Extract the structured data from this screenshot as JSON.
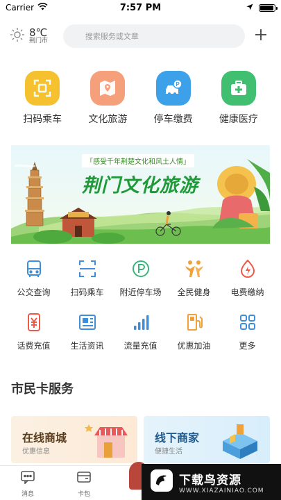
{
  "status_bar": {
    "carrier": "Carrier",
    "time": "7:57 PM",
    "battery_level": 0.95
  },
  "header": {
    "temperature": "8℃",
    "city": "荆门市",
    "search_placeholder": "搜索服务或文章"
  },
  "top_services": [
    {
      "label": "扫码乘车",
      "icon": "scan-icon",
      "color": "#f5c12e"
    },
    {
      "label": "文化旅游",
      "icon": "map-icon",
      "color": "#f5a07a"
    },
    {
      "label": "停车缴费",
      "icon": "car-parking-icon",
      "color": "#3da1ea"
    },
    {
      "label": "健康医疗",
      "icon": "medical-kit-icon",
      "color": "#3fbf6f"
    }
  ],
  "banner": {
    "tagline": "「感受千年荆楚文化和风土人情」",
    "title": "荆门文化旅游"
  },
  "grid_items": [
    {
      "label": "公交查询",
      "icon": "bus-icon",
      "color": "#3f8fd8"
    },
    {
      "label": "扫码乘车",
      "icon": "scan-icon",
      "color": "#3f8fd8"
    },
    {
      "label": "附近停车场",
      "icon": "parking-icon",
      "color": "#3ab47a"
    },
    {
      "label": "全民健身",
      "icon": "fitness-icon",
      "color": "#f2a13a"
    },
    {
      "label": "电费缴纳",
      "icon": "electricity-icon",
      "color": "#ee5a4a"
    },
    {
      "label": "话费充值",
      "icon": "phone-bill-icon",
      "color": "#ee5a4a"
    },
    {
      "label": "生活资讯",
      "icon": "news-icon",
      "color": "#3f8fd8"
    },
    {
      "label": "流量充值",
      "icon": "signal-icon",
      "color": "#3f8fd8"
    },
    {
      "label": "优惠加油",
      "icon": "fuel-icon",
      "color": "#f2a13a"
    },
    {
      "label": "更多",
      "icon": "more-grid-icon",
      "color": "#3f8fd8"
    }
  ],
  "citizen_card": {
    "title": "市民卡服务",
    "cards": [
      {
        "title": "在线商城",
        "subtitle": "优惠信息",
        "color": "#5a3d1f"
      },
      {
        "title": "线下商家",
        "subtitle": "便捷生活",
        "color": "#215a8a"
      }
    ]
  },
  "tabbar": {
    "tabs": [
      {
        "label": "消息",
        "icon": "message-icon"
      },
      {
        "label": "卡包",
        "icon": "wallet-icon"
      }
    ]
  },
  "watermark": {
    "title": "下载鸟资源",
    "url": "WWW.XIAZAINIAO.COM"
  }
}
